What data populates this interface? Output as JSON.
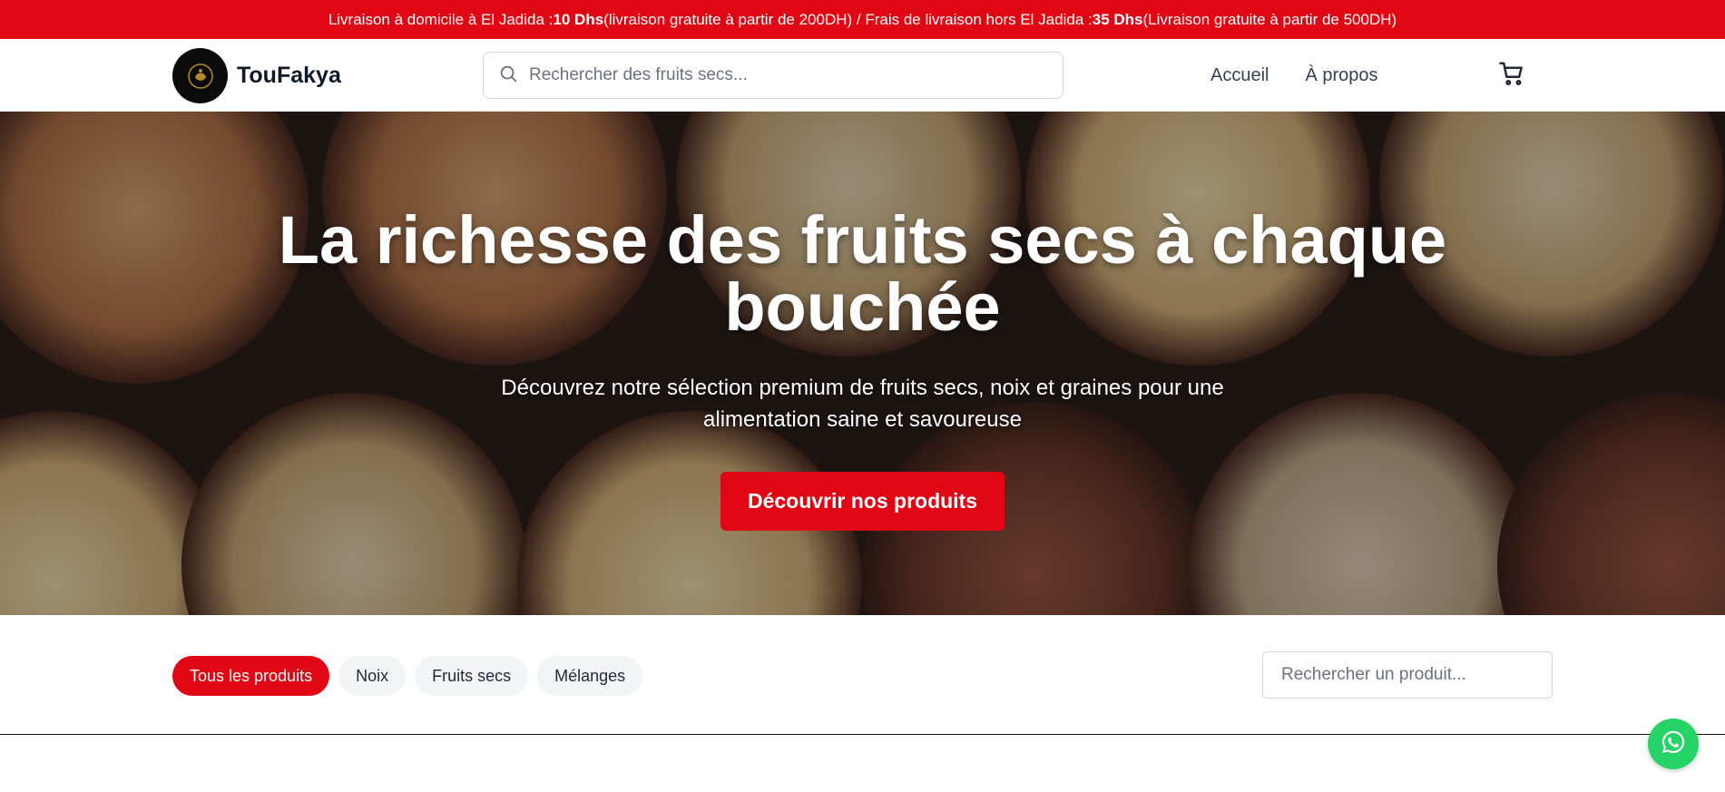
{
  "announcement": {
    "part1": "Livraison à domicile à El Jadida : ",
    "price1": "10 Dhs",
    "part2": " (livraison gratuite à partir de 200DH) / Frais de livraison hors El Jadida : ",
    "price2": "35 Dhs",
    "part3": "(Livraison gratuite à partir de 500DH)"
  },
  "brand": {
    "name": "TouFakya"
  },
  "search": {
    "placeholder": "Rechercher des fruits secs..."
  },
  "nav": {
    "home": "Accueil",
    "about": "À propos"
  },
  "hero": {
    "title": "La richesse des fruits secs à chaque bouchée",
    "subtitle": "Découvrez notre sélection premium de fruits secs, noix et graines pour une alimentation saine et savoureuse",
    "cta": "Découvrir nos produits"
  },
  "filters": {
    "chips": [
      "Tous les produits",
      "Noix",
      "Fruits secs",
      "Mélanges"
    ],
    "active": "Tous les produits",
    "search_placeholder": "Rechercher un produit..."
  },
  "colors": {
    "accent": "#e10613",
    "whatsapp": "#25d366"
  },
  "icons": {
    "search": "search-icon",
    "cart": "cart-icon",
    "whatsapp": "whatsapp-icon"
  }
}
